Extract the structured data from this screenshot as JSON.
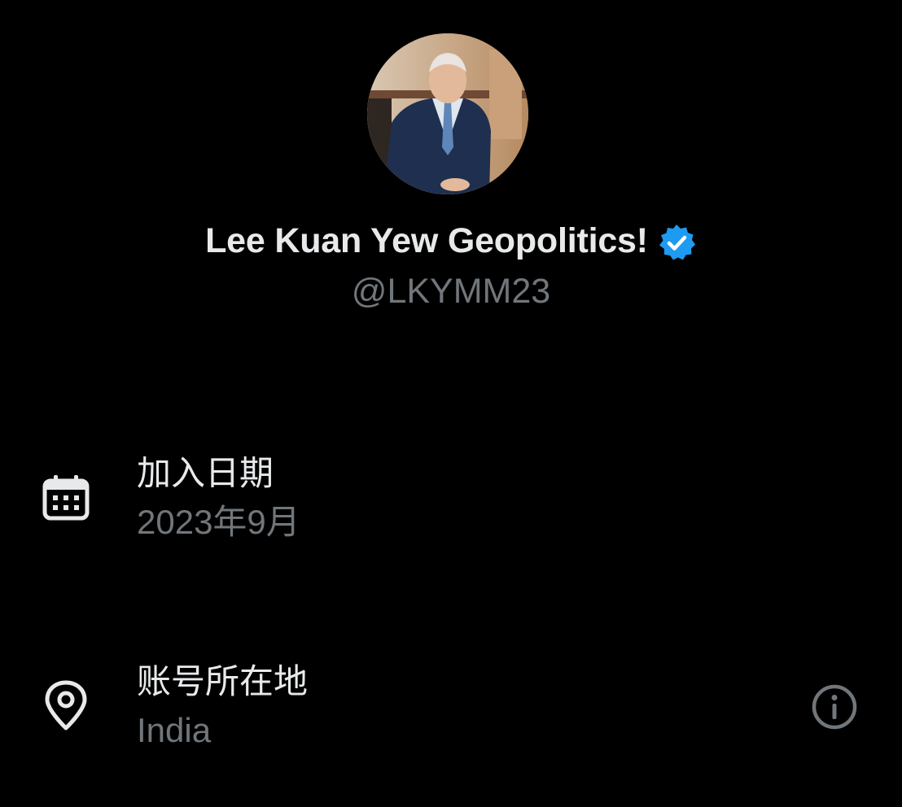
{
  "profile": {
    "display_name": "Lee Kuan Yew Geopolitics!",
    "handle": "@LKYMM23",
    "verified": true,
    "avatar_icon": "profile-photo-avatar",
    "badge_icon": "verified-badge-icon"
  },
  "about": {
    "joined": {
      "icon": "calendar-icon",
      "title": "加入日期",
      "value": "2023年9月"
    },
    "location": {
      "icon": "location-pin-icon",
      "title": "账号所在地",
      "value": "India",
      "info_icon": "info-icon"
    }
  },
  "colors": {
    "background": "#000000",
    "primary_text": "#e7e9ea",
    "secondary_text": "#71767b",
    "verified_blue": "#1d9bf0"
  }
}
